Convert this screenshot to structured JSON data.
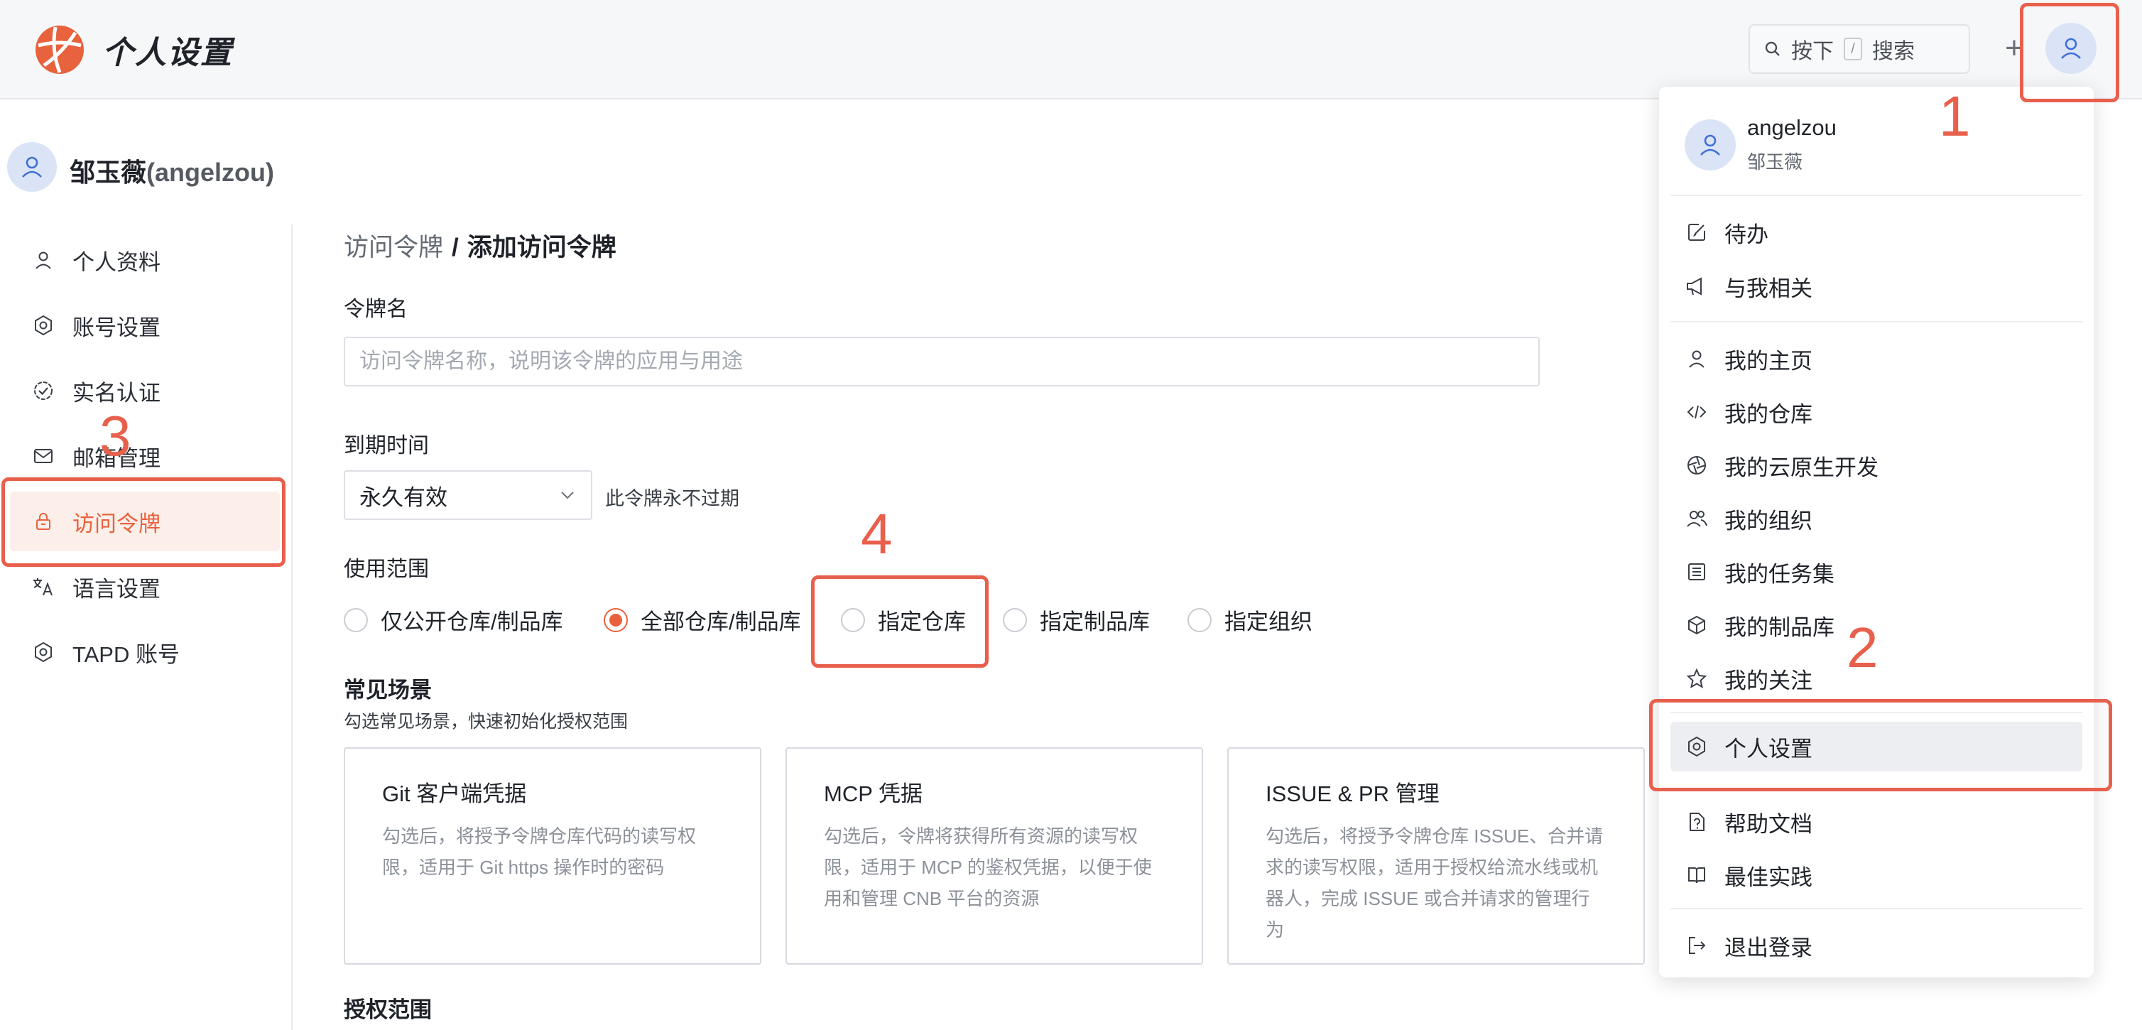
{
  "header": {
    "title": "个人设置",
    "search": {
      "label_press": "按下",
      "key": "/",
      "label_search": "搜索"
    },
    "plus": "+"
  },
  "user": {
    "name": "邹玉薇",
    "handle": "(angelzou)"
  },
  "sidebar": {
    "items": [
      {
        "label": "个人资料",
        "icon": "user-icon"
      },
      {
        "label": "账号设置",
        "icon": "hexagon-gear-icon"
      },
      {
        "label": "实名认证",
        "icon": "verified-badge-icon"
      },
      {
        "label": "邮箱管理",
        "icon": "mail-icon"
      },
      {
        "label": "访问令牌",
        "icon": "lock-icon",
        "active": true
      },
      {
        "label": "语言设置",
        "icon": "translate-icon"
      },
      {
        "label": "TAPD 账号",
        "icon": "hexagon-gear-icon"
      }
    ]
  },
  "main": {
    "breadcrumb": {
      "parent": "访问令牌",
      "separator": "/",
      "current": "添加访问令牌"
    },
    "token_name": {
      "label": "令牌名",
      "placeholder": "访问令牌名称，说明该令牌的应用与用途",
      "value": ""
    },
    "expiry": {
      "label": "到期时间",
      "selected": "永久有效",
      "hint": "此令牌永不过期"
    },
    "scope": {
      "label": "使用范围",
      "options": [
        {
          "label": "仅公开仓库/制品库",
          "checked": false
        },
        {
          "label": "全部仓库/制品库",
          "checked": true
        },
        {
          "label": "指定仓库",
          "checked": false
        },
        {
          "label": "指定制品库",
          "checked": false
        },
        {
          "label": "指定组织",
          "checked": false
        }
      ]
    },
    "scenarios": {
      "title": "常见场景",
      "subtitle": "勾选常见场景，快速初始化授权范围",
      "cards": [
        {
          "title": "Git 客户端凭据",
          "desc": "勾选后，将授予令牌仓库代码的读写权限，适用于 Git https 操作时的密码"
        },
        {
          "title": "MCP 凭据",
          "desc": "勾选后，令牌将获得所有资源的读写权限，适用于 MCP 的鉴权凭据，以便于使用和管理 CNB 平台的资源"
        },
        {
          "title": "ISSUE & PR 管理",
          "desc": "勾选后，将授予令牌仓库 ISSUE、合并请求的读写权限，适用于授权给流水线或机器人，完成 ISSUE 或合并请求的管理行为"
        }
      ]
    },
    "auth_scope_title": "授权范围"
  },
  "dropdown": {
    "username": "angelzou",
    "realname": "邹玉薇",
    "group1": [
      {
        "label": "待办",
        "icon": "edit-icon"
      },
      {
        "label": "与我相关",
        "icon": "megaphone-icon"
      }
    ],
    "group2": [
      {
        "label": "我的主页",
        "icon": "user-icon"
      },
      {
        "label": "我的仓库",
        "icon": "code-icon"
      },
      {
        "label": "我的云原生开发",
        "icon": "aperture-icon"
      },
      {
        "label": "我的组织",
        "icon": "users-icon"
      },
      {
        "label": "我的任务集",
        "icon": "list-icon"
      },
      {
        "label": "我的制品库",
        "icon": "cube-icon"
      },
      {
        "label": "我的关注",
        "icon": "star-icon"
      }
    ],
    "group3": [
      {
        "label": "个人设置",
        "icon": "hexagon-gear-icon",
        "highlighted": true
      },
      {
        "label": "帮助文档",
        "icon": "doc-question-icon"
      },
      {
        "label": "最佳实践",
        "icon": "book-icon"
      }
    ],
    "group4": [
      {
        "label": "退出登录",
        "icon": "logout-icon"
      }
    ]
  },
  "annotations": [
    "1",
    "2",
    "3",
    "4"
  ],
  "colors": {
    "accent": "#e8623d",
    "annotation": "#e8604c",
    "active_bg": "#fcefea"
  }
}
